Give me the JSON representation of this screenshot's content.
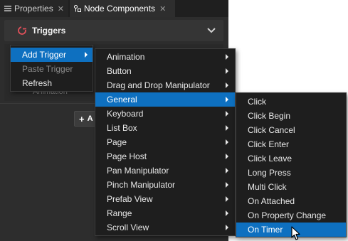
{
  "tabs": [
    {
      "label": "Properties",
      "close": "✕"
    },
    {
      "label": "Node Components",
      "close": "✕"
    }
  ],
  "triggers": {
    "title": "Triggers",
    "ghost_item": "Animation",
    "add_button_label": "+",
    "add_button_text": "A"
  },
  "context_menu": {
    "items": [
      {
        "label": "Add Trigger",
        "selected": true,
        "has_submenu": true
      },
      {
        "label": "Paste Trigger",
        "disabled": true
      },
      {
        "label": "Refresh"
      }
    ]
  },
  "trigger_types_menu": {
    "items": [
      {
        "label": "Animation",
        "has_submenu": true
      },
      {
        "label": "Button",
        "has_submenu": true
      },
      {
        "label": "Drag and Drop Manipulator",
        "has_submenu": true
      },
      {
        "label": "General",
        "selected": true,
        "has_submenu": true
      },
      {
        "label": "Keyboard",
        "has_submenu": true
      },
      {
        "label": "List Box",
        "has_submenu": true
      },
      {
        "label": "Page",
        "has_submenu": true
      },
      {
        "label": "Page Host",
        "has_submenu": true
      },
      {
        "label": "Pan Manipulator",
        "has_submenu": true
      },
      {
        "label": "Pinch Manipulator",
        "has_submenu": true
      },
      {
        "label": "Prefab View",
        "has_submenu": true
      },
      {
        "label": "Range",
        "has_submenu": true
      },
      {
        "label": "Scroll View",
        "has_submenu": true
      }
    ]
  },
  "general_menu": {
    "items": [
      {
        "label": "Click"
      },
      {
        "label": "Click Begin"
      },
      {
        "label": "Click Cancel"
      },
      {
        "label": "Click Enter"
      },
      {
        "label": "Click Leave"
      },
      {
        "label": "Long Press"
      },
      {
        "label": "Multi Click"
      },
      {
        "label": "On Attached"
      },
      {
        "label": "On Property Change"
      },
      {
        "label": "On Timer",
        "selected": true
      }
    ]
  },
  "colors": {
    "selection": "#0e70c0",
    "panel": "#2d2d2d",
    "menu": "#1e1e1e",
    "trigger_icon": "#e0505a"
  }
}
